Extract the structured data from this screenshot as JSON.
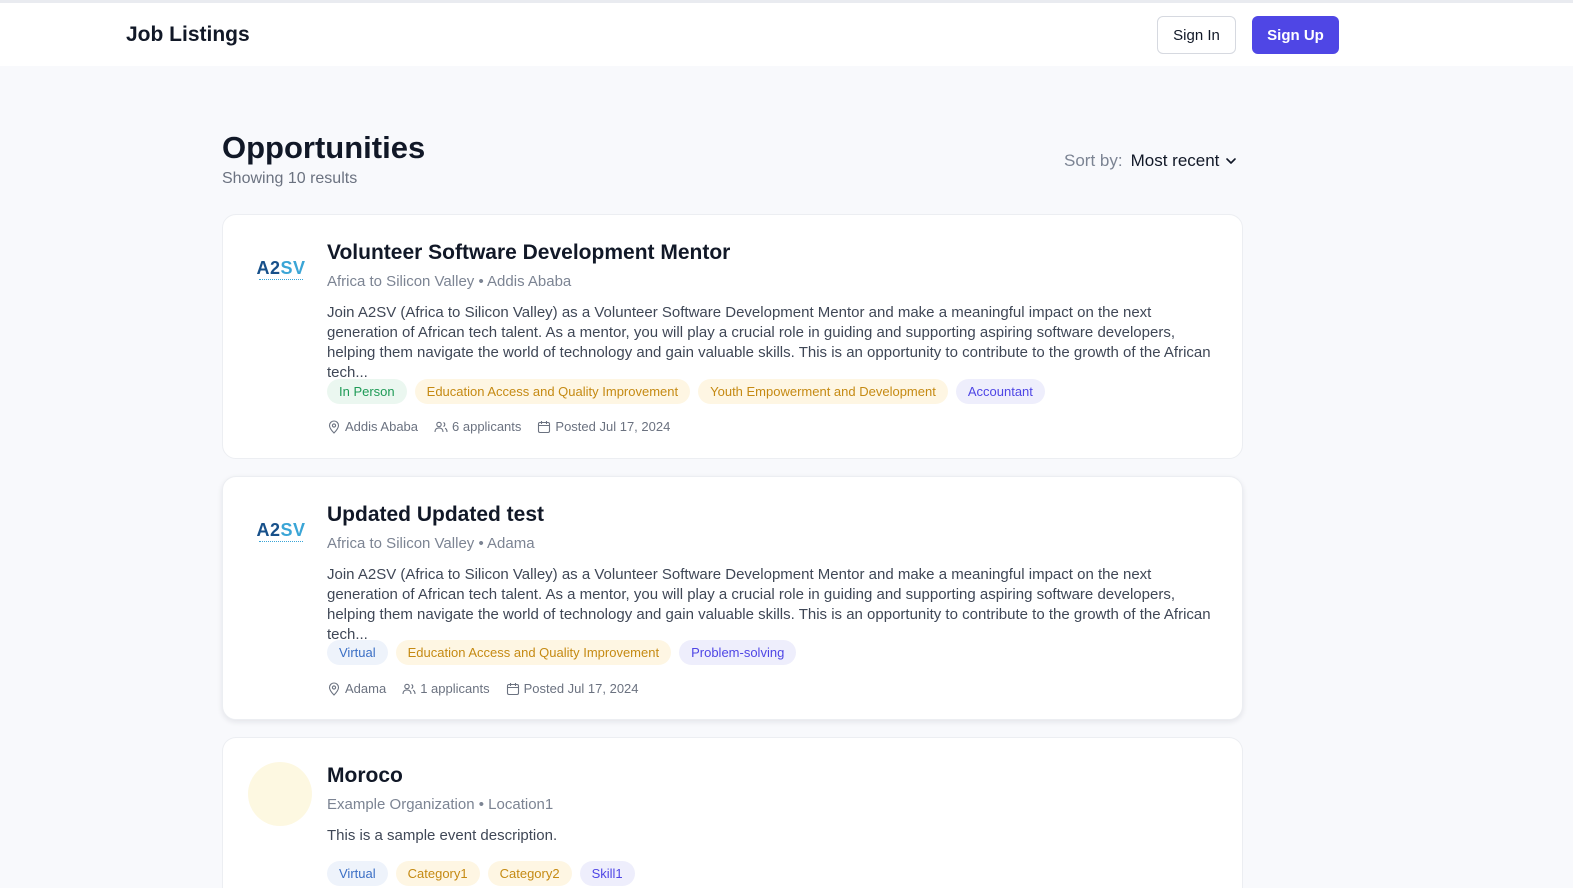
{
  "header": {
    "title": "Job Listings",
    "sign_in_label": "Sign In",
    "sign_up_label": "Sign Up"
  },
  "main": {
    "title": "Opportunities",
    "results_text": "Showing 10 results",
    "sort_label": "Sort by:",
    "sort_value": "Most recent"
  },
  "jobs": [
    {
      "title": "Volunteer Software Development Mentor",
      "meta": "Africa to Silicon Valley • Addis Ababa",
      "description": "Join A2SV (Africa to Silicon Valley) as a Volunteer Software Development Mentor and make a meaningful impact on the next generation of African tech talent. As a mentor, you will play a crucial role in guiding and supporting aspiring software developers, helping them navigate the world of technology and gain valuable skills. This is an opportunity to contribute to the growth of the African tech...",
      "logo_text": "A2SV",
      "tags": [
        "In Person",
        "Education Access and Quality Improvement",
        "Youth Empowerment and Development",
        "Accountant"
      ],
      "location": "Addis Ababa",
      "applicants": "6 applicants",
      "posted": "Posted Jul 17, 2024"
    },
    {
      "title": "Updated Updated test",
      "meta": "Africa to Silicon Valley • Adama",
      "description": "Join A2SV (Africa to Silicon Valley) as a Volunteer Software Development Mentor and make a meaningful impact on the next generation of African tech talent. As a mentor, you will play a crucial role in guiding and supporting aspiring software developers, helping them navigate the world of technology and gain valuable skills. This is an opportunity to contribute to the growth of the African tech...",
      "logo_text": "A2SV",
      "tags": [
        "Virtual",
        "Education Access and Quality Improvement",
        "Problem-solving"
      ],
      "location": "Adama",
      "applicants": "1 applicants",
      "posted": "Posted Jul 17, 2024"
    },
    {
      "title": "Moroco",
      "meta": "Example Organization • Location1",
      "description": "This is a sample event description.",
      "tags": [
        "Virtual",
        "Category1",
        "Category2",
        "Skill1"
      ]
    }
  ],
  "colors": {
    "accent": "#4f46e5",
    "tag_green": "#1f9b57",
    "tag_amber": "#c58a13",
    "tag_purple": "#4f46e5",
    "tag_blue": "#3b6fc5"
  }
}
